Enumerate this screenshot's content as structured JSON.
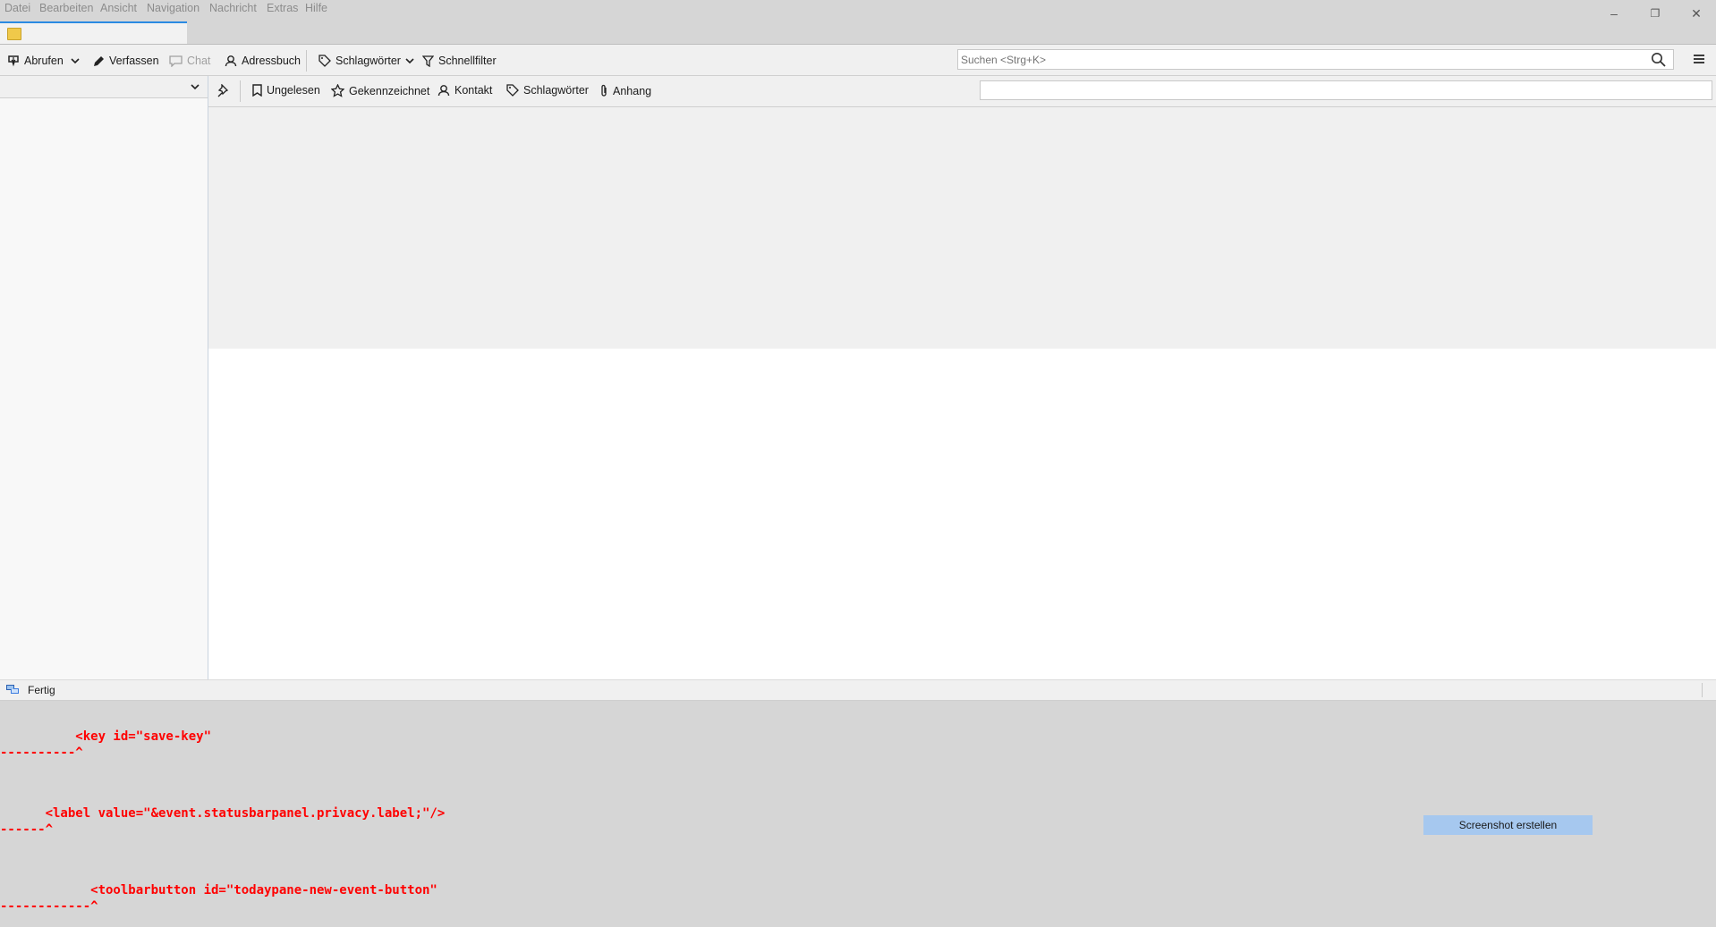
{
  "menubar": {
    "items": [
      "Datei",
      "Bearbeiten",
      "Ansicht",
      "Navigation",
      "Nachricht",
      "Extras",
      "Hilfe"
    ]
  },
  "window_controls": {
    "minimize": "–",
    "restore": "❐",
    "close": "✕"
  },
  "toolbar": {
    "get_messages": "Abrufen",
    "write": "Verfassen",
    "chat": "Chat",
    "address_book": "Adressbuch",
    "tags": "Schlagwörter",
    "quick_filter": "Schnellfilter",
    "search_placeholder": "Suchen <Strg+K>"
  },
  "quickfilter": {
    "unread": "Ungelesen",
    "starred": "Gekennzeichnet",
    "contact": "Kontakt",
    "tags": "Schlagwörter",
    "attachment": "Anhang",
    "filter_value": ""
  },
  "statusbar": {
    "text": "Fertig"
  },
  "error_output": {
    "line1": "          <key id=\"save-key\"",
    "line1_marker": "----------^",
    "line2": "      <label value=\"&event.statusbarpanel.privacy.label;\"/>",
    "line2_marker": "------^",
    "line3": "            <toolbarbutton id=\"todaypane-new-event-button\"",
    "line3_marker": "------------^"
  },
  "screenshot_button": "Screenshot erstellen",
  "colors": {
    "accent": "#2b8ae2",
    "error_text": "#ff0000",
    "screenshot_button_bg": "#a6c8ef"
  }
}
